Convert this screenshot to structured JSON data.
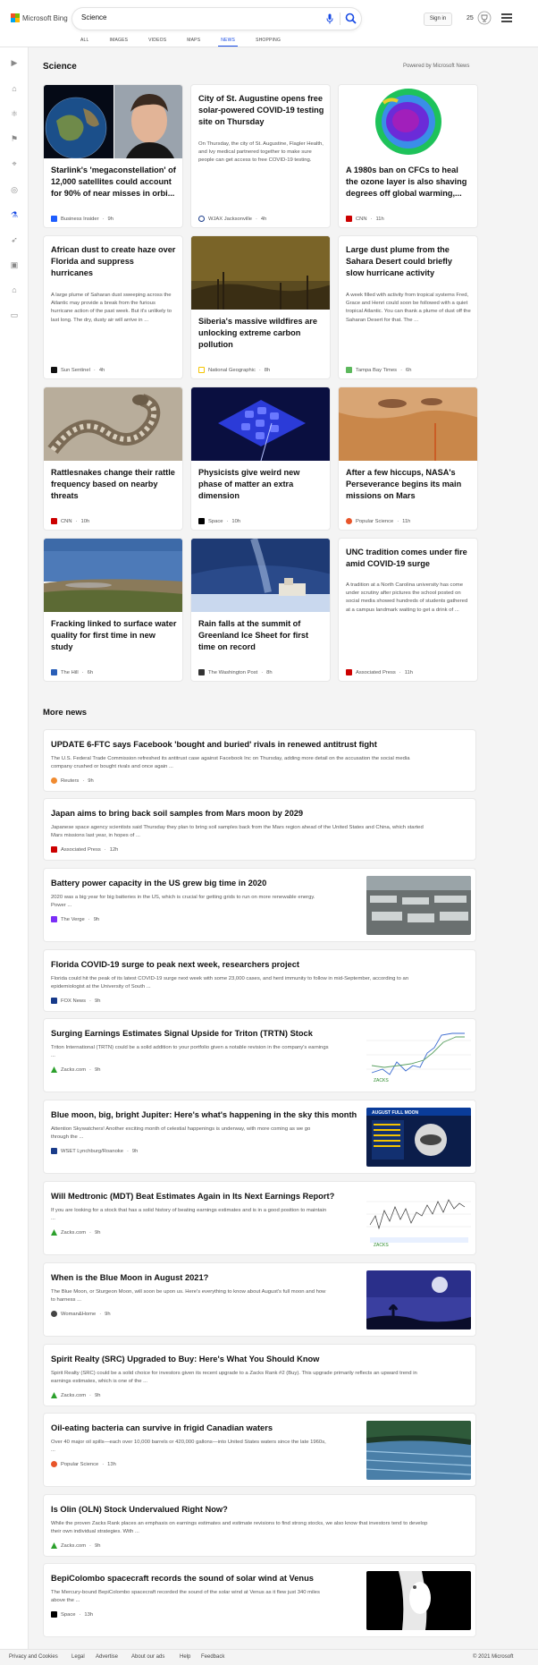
{
  "header": {
    "brand": "Microsoft Bing",
    "query": "Science",
    "signin": "Sign in",
    "rewards_count": "25",
    "tabs": [
      "ALL",
      "IMAGES",
      "VIDEOS",
      "MAPS",
      "NEWS",
      "SHOPPING"
    ],
    "active_tab": "NEWS",
    "accent": "#174ae4"
  },
  "section": {
    "title": "Science",
    "powered_by": "Powered by Microsoft News"
  },
  "cards": [
    {
      "title": "Starlink's 'megaconstellation' of 12,000 satellites could account for 90% of near misses in orbi...",
      "snippet": "",
      "source": "Business Insider",
      "time": "9h"
    },
    {
      "title": "City of St. Augustine opens free solar-powered COVID-19 testing site on Thursday",
      "snippet": "On Thursday, the city of St. Augustine, Flagler Health, and Ivy medical partnered together to make sure people can get access to free COVID-19 testing.",
      "source": "WJAX Jacksonville",
      "time": "4h"
    },
    {
      "title": "A 1980s ban on CFCs to heal the ozone layer is also shaving degrees off global warming,...",
      "snippet": "",
      "source": "CNN",
      "time": "11h"
    },
    {
      "title": "African dust to create haze over Florida and suppress hurricanes",
      "snippet": "A large plume of Saharan dust sweeping across the Atlantic may provide a break from the furious hurricane action of the past week. But it's unlikely to last long. The dry, dusty air will arrive in ...",
      "source": "Sun Sentinel",
      "time": "4h"
    },
    {
      "title": "Siberia's massive wildfires are unlocking extreme carbon pollution",
      "snippet": "",
      "source": "National Geographic",
      "time": "8h"
    },
    {
      "title": "Large dust plume from the Sahara Desert could briefly slow hurricane activity",
      "snippet": "A week filled with activity from tropical systems Fred, Grace and Henri could soon be followed with a quiet tropical Atlantic. You can thank a plume of dust off the Saharan Desert for that. The ...",
      "source": "Tampa Bay Times",
      "time": "6h"
    },
    {
      "title": "Rattlesnakes change their rattle frequency based on nearby threats",
      "snippet": "",
      "source": "CNN",
      "time": "10h"
    },
    {
      "title": "Physicists give weird new phase of matter an extra dimension",
      "snippet": "",
      "source": "Space",
      "time": "10h"
    },
    {
      "title": "After a few hiccups, NASA's Perseverance begins its main missions on Mars",
      "snippet": "",
      "source": "Popular Science",
      "time": "11h"
    },
    {
      "title": "Fracking linked to surface water quality for first time in new study",
      "snippet": "",
      "source": "The Hill",
      "time": "6h"
    },
    {
      "title": "Rain falls at the summit of Greenland Ice Sheet for first time on record",
      "snippet": "",
      "source": "The Washington Post",
      "time": "8h"
    },
    {
      "title": "UNC tradition comes under fire amid COVID-19 surge",
      "snippet": "A tradition at a North Carolina university has come under scrutiny after pictures the school posted on social media showed hundreds of students gathered at a campus landmark waiting to get a drink of ...",
      "source": "Associated Press",
      "time": "11h"
    }
  ],
  "more_news": {
    "title": "More news",
    "items": [
      {
        "title": "UPDATE 6-FTC says Facebook 'bought and buried' rivals in renewed antitrust fight",
        "snippet1": "The U.S. Federal Trade Commission refreshed its antitrust case against Facebook Inc on Thursday, adding more detail on the accusation the social media",
        "snippet2": "company crushed or bought rivals and once again ...",
        "source": "Reuters",
        "time": "9h"
      },
      {
        "title": "Japan aims to bring back soil samples from Mars moon by 2029",
        "snippet1": "Japanese space agency scientists said Thursday they plan to bring soil samples back from the Mars region ahead of the United States and China, which started",
        "snippet2": "Mars missions last year, in hopes of ...",
        "source": "Associated Press",
        "time": "12h"
      },
      {
        "title": "Battery power capacity in the US grew big time in 2020",
        "snippet1": "2020 was a big year for big batteries in the US, which is crucial for getting grids to run on more renewable energy.",
        "snippet2": "Power ...",
        "source": "The Verge",
        "time": "9h"
      },
      {
        "title": "Florida COVID-19 surge to peak next week, researchers project",
        "snippet1": "Florida could hit the peak of its latest COVID-19 surge next week with some 23,000 cases, and herd immunity to follow in mid-September, according to an",
        "snippet2": "epidemiologist at the University of South ...",
        "source": "FOX News",
        "time": "9h"
      },
      {
        "title": "Surging Earnings Estimates Signal Upside for Triton (TRTN) Stock",
        "snippet1": "Triton International (TRTN) could be a solid addition to your portfolio given a notable revision in the company's earnings",
        "snippet2": "...",
        "source": "Zacks.com",
        "time": "9h"
      },
      {
        "title": "Blue moon, big, bright Jupiter: Here's what's happening in the sky this month",
        "snippet1": "Attention Skywatchers! Another exciting month of celestial happenings is underway, with more coming as we go",
        "snippet2": "through the ...",
        "source": "WSET Lynchburg/Roanoke",
        "time": "9h"
      },
      {
        "title": "Will Medtronic (MDT) Beat Estimates Again in Its Next Earnings Report?",
        "snippet1": "If you are looking for a stock that has a solid history of beating earnings estimates and is in a good position to maintain",
        "snippet2": "...",
        "source": "Zacks.com",
        "time": "9h"
      },
      {
        "title": "When is the Blue Moon in August 2021?",
        "snippet1": "The Blue Moon, or Sturgeon Moon, will soon be upon us. Here's everything to know about August's full moon and how",
        "snippet2": "to harness ...",
        "source": "Woman&Home",
        "time": "9h"
      },
      {
        "title": "Spirit Realty (SRC) Upgraded to Buy: Here's What You Should Know",
        "snippet1": "Spirit Realty (SRC) could be a solid choice for investors given its recent upgrade to a Zacks Rank #2 (Buy). This upgrade primarily reflects an upward trend in",
        "snippet2": "earnings estimates, which is one of the ...",
        "source": "Zacks.com",
        "time": "9h"
      },
      {
        "title": "Oil-eating bacteria can survive in frigid Canadian waters",
        "snippet1": "Over 40 major oil spills—each over 10,000 barrels or 420,000 gallons—into United States waters since the late 1960s,",
        "snippet2": "...",
        "source": "Popular Science",
        "time": "13h"
      },
      {
        "title": "Is Olin (OLN) Stock Undervalued Right Now?",
        "snippet1": "While the proven Zacks Rank places an emphasis on earnings estimates and estimate revisions to find strong stocks, we also know that investors tend to develop",
        "snippet2": "their own individual strategies. With ...",
        "source": "Zacks.com",
        "time": "9h"
      },
      {
        "title": "BepiColombo spacecraft records the sound of solar wind at Venus",
        "snippet1": "The Mercury-bound BepiColombo spacecraft recorded the sound of the solar wind at Venus as it flew just 340 miles",
        "snippet2": "above the ...",
        "source": "Space",
        "time": "13h"
      }
    ]
  },
  "thumb_text": {
    "moon_header": "AUGUST FULL MOON",
    "zacks": "ZACKS"
  },
  "footer": {
    "links": [
      "Privacy and Cookies",
      "Legal",
      "Advertise",
      "About our ads",
      "Help",
      "Feedback"
    ],
    "copyright": "© 2021 Microsoft"
  }
}
